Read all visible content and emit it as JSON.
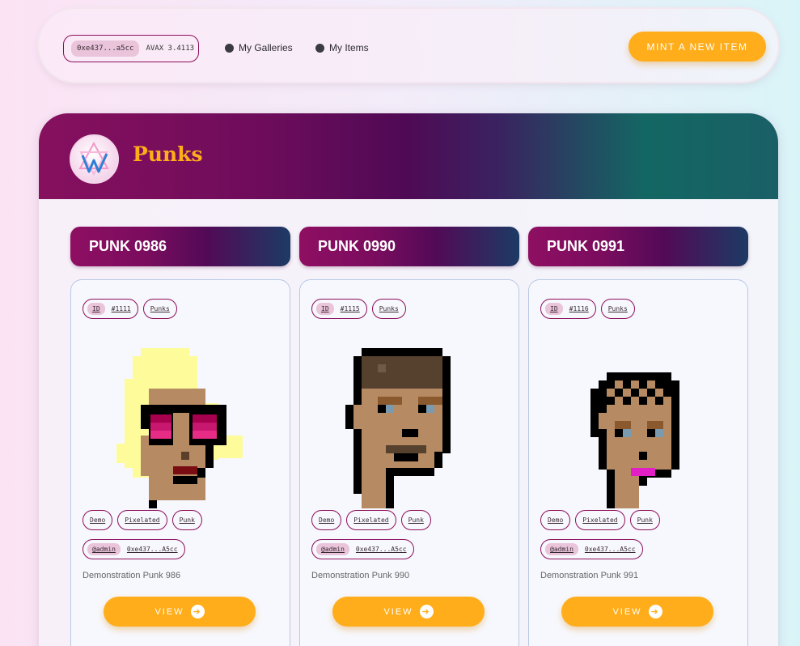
{
  "wallet": {
    "address": "0xe437...a5cc",
    "balance": "AVAX 3.4113"
  },
  "nav": {
    "galleries": "My Galleries",
    "items": "My Items",
    "mint": "MINT A NEW ITEM"
  },
  "gallery": {
    "title": "Punks"
  },
  "cards": [
    {
      "title": "PUNK 0986",
      "id_label": "ID",
      "id": "#1111",
      "collection": "Punks",
      "tags": [
        "Demo",
        "Pixelated",
        "Punk"
      ],
      "owner_role": "@admin",
      "owner_addr": "0xe437...A5cc",
      "description": "Demonstration Punk 986",
      "view": "VIEW"
    },
    {
      "title": "PUNK 0990",
      "id_label": "ID",
      "id": "#1115",
      "collection": "Punks",
      "tags": [
        "Demo",
        "Pixelated",
        "Punk"
      ],
      "owner_role": "@admin",
      "owner_addr": "0xe437...A5cc",
      "description": "Demonstration Punk 990",
      "view": "VIEW"
    },
    {
      "title": "PUNK 0991",
      "id_label": "ID",
      "id": "#1116",
      "collection": "Punks",
      "tags": [
        "Demo",
        "Pixelated",
        "Punk"
      ],
      "owner_role": "@admin",
      "owner_addr": "0xe437...A5cc",
      "description": "Demonstration Punk 991",
      "view": "VIEW"
    }
  ],
  "icons": {
    "arrow": "arrow-right-circle-icon",
    "nav_dot": "dot-icon",
    "logo": "gallery-logo-icon"
  },
  "colors": {
    "accent": "#ffad1a",
    "brand": "#8b0d5a",
    "teal": "#136763"
  }
}
